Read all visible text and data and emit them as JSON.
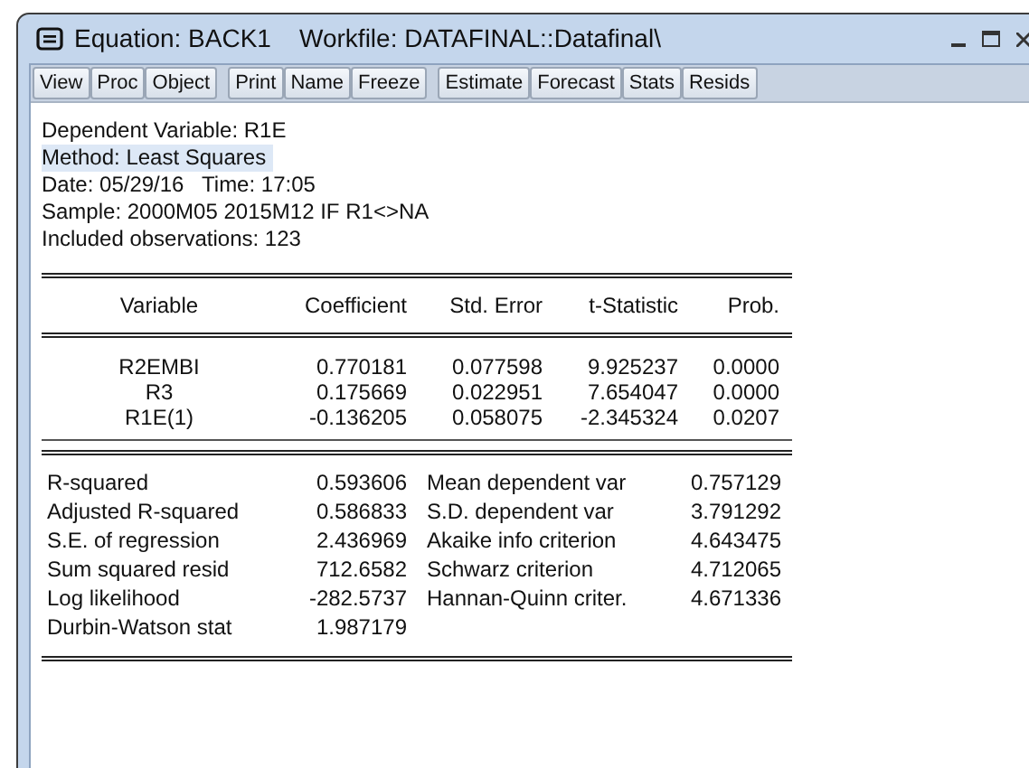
{
  "window": {
    "title": "Equation: BACK1    Workfile: DATAFINAL::Datafinal\\"
  },
  "toolbar": {
    "groups": [
      [
        "View",
        "Proc",
        "Object"
      ],
      [
        "Print",
        "Name",
        "Freeze"
      ],
      [
        "Estimate",
        "Forecast",
        "Stats",
        "Resids"
      ]
    ]
  },
  "header_lines": [
    {
      "text": "Dependent Variable: R1E",
      "highlighted": false
    },
    {
      "text": "Method: Least Squares",
      "highlighted": true
    },
    {
      "text": "Date: 05/29/16   Time: 17:05",
      "highlighted": false
    },
    {
      "text": "Sample: 2000M05 2015M12 IF R1<>NA",
      "highlighted": false
    },
    {
      "text": "Included observations: 123",
      "highlighted": false
    }
  ],
  "coefficients": {
    "columns": [
      "Variable",
      "Coefficient",
      "Std. Error",
      "t-Statistic",
      "Prob."
    ],
    "rows": [
      [
        "R2EMBI",
        "0.770181",
        "0.077598",
        "9.925237",
        "0.0000"
      ],
      [
        "R3",
        "0.175669",
        "0.022951",
        "7.654047",
        "0.0000"
      ],
      [
        "R1E(1)",
        "-0.136205",
        "0.058075",
        "-2.345324",
        "0.0207"
      ]
    ]
  },
  "statistics": [
    [
      "R-squared",
      "0.593606",
      "Mean dependent var",
      "0.757129"
    ],
    [
      "Adjusted R-squared",
      "0.586833",
      "S.D. dependent var",
      "3.791292"
    ],
    [
      "S.E. of regression",
      "2.436969",
      "Akaike info criterion",
      "4.643475"
    ],
    [
      "Sum squared resid",
      "712.6582",
      "Schwarz criterion",
      "4.712065"
    ],
    [
      "Log likelihood",
      "-282.5737",
      "Hannan-Quinn criter.",
      "4.671336"
    ],
    [
      "Durbin-Watson stat",
      "1.987179"
    ]
  ]
}
